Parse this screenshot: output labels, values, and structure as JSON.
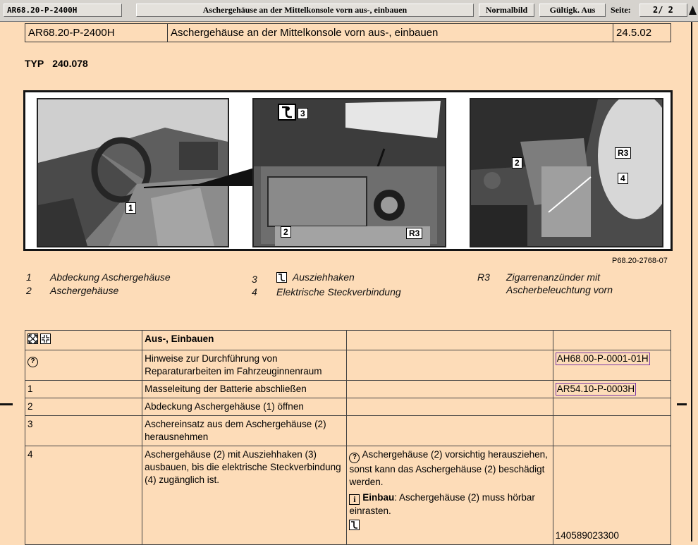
{
  "toolbar": {
    "doc_code": "AR68.20-P-2400H",
    "title": "Aschergehäuse an der Mittelkonsole vorn aus-, einbauen",
    "normal_label": "Normalbild",
    "validity_label": "Gültigk. Aus",
    "page_label": "Seite:",
    "page_value": "2/  2"
  },
  "header": {
    "code": "AR68.20-P-2400H",
    "title": "Aschergehäuse an der Mittelkonsole vorn aus-, einbauen",
    "date": "24.5.02"
  },
  "typ": {
    "label": "TYP",
    "value": "240.078"
  },
  "figure": {
    "id": "P68.20-2768-07",
    "callouts": {
      "c1": "1",
      "c2": "2",
      "c3": "3",
      "r3": "R3",
      "p3_2": "2",
      "p3_r3": "R3",
      "p3_4": "4"
    }
  },
  "legend": [
    {
      "num": "1",
      "text": "Abdeckung Aschergehäuse"
    },
    {
      "num": "2",
      "text": "Aschergehäuse"
    },
    {
      "num": "3",
      "text": "Ausziehhaken"
    },
    {
      "num": "4",
      "text": "Elektrische Steckverbindung"
    },
    {
      "num": "R3",
      "text1": "Zigarrenanzünder mit",
      "text2": "Ascherbeleuchtung vorn"
    }
  ],
  "table": {
    "header_title": "Aus-, Einbauen",
    "rows": [
      {
        "step": "",
        "text": "Hinweise zur Durchführung von Reparaturarbeiten im Fahrzeuginnenraum",
        "note": "",
        "ref": "AH68.00-P-0001-01H"
      },
      {
        "step": "1",
        "text": "Masseleitung der Batterie abschließen",
        "note": "",
        "ref": "AR54.10-P-0003H"
      },
      {
        "step": "2",
        "text": "Abdeckung Aschergehäuse (1) öffnen",
        "note": "",
        "ref": ""
      },
      {
        "step": "3",
        "text": "Aschereinsatz aus dem Aschergehäuse (2) herausnehmen",
        "note": "",
        "ref": ""
      },
      {
        "step": "4",
        "text": "Aschergehäuse (2) mit Ausziehhaken (3) ausbauen, bis die elektrische Steckverbindung (4) zugänglich ist.",
        "note": "Aschergehäuse (2) vorsichtig herausziehen, sonst kann das Aschergehäuse (2) beschädigt werden.",
        "note2_bold": "Einbau",
        "note2": ": Aschergehäuse (2) muss hörbar einrasten.",
        "ref": "140589023300"
      }
    ]
  },
  "icons": {
    "expand": "expand-all-icon",
    "collapse": "collapse-all-icon",
    "hint": "hint-icon",
    "info": "info-icon",
    "hook": "puller-hook-icon"
  }
}
